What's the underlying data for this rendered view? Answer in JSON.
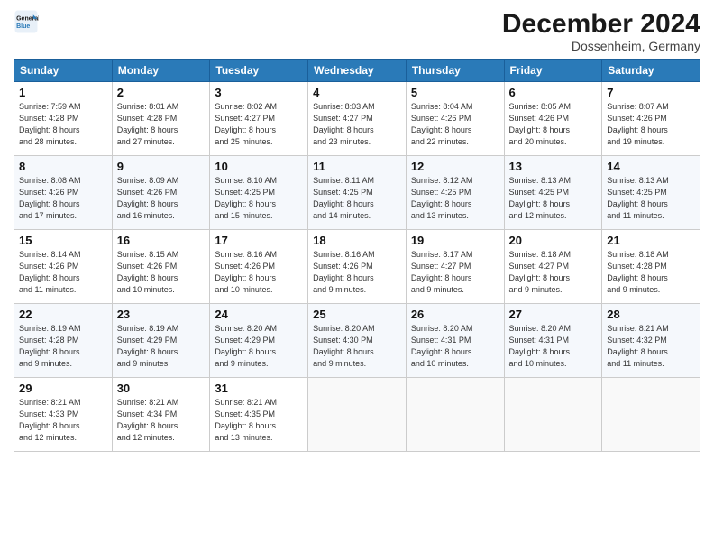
{
  "header": {
    "logo_line1": "General",
    "logo_line2": "Blue",
    "month": "December 2024",
    "location": "Dossenheim, Germany"
  },
  "weekdays": [
    "Sunday",
    "Monday",
    "Tuesday",
    "Wednesday",
    "Thursday",
    "Friday",
    "Saturday"
  ],
  "weeks": [
    [
      {
        "day": "1",
        "info": "Sunrise: 7:59 AM\nSunset: 4:28 PM\nDaylight: 8 hours\nand 28 minutes."
      },
      {
        "day": "2",
        "info": "Sunrise: 8:01 AM\nSunset: 4:28 PM\nDaylight: 8 hours\nand 27 minutes."
      },
      {
        "day": "3",
        "info": "Sunrise: 8:02 AM\nSunset: 4:27 PM\nDaylight: 8 hours\nand 25 minutes."
      },
      {
        "day": "4",
        "info": "Sunrise: 8:03 AM\nSunset: 4:27 PM\nDaylight: 8 hours\nand 23 minutes."
      },
      {
        "day": "5",
        "info": "Sunrise: 8:04 AM\nSunset: 4:26 PM\nDaylight: 8 hours\nand 22 minutes."
      },
      {
        "day": "6",
        "info": "Sunrise: 8:05 AM\nSunset: 4:26 PM\nDaylight: 8 hours\nand 20 minutes."
      },
      {
        "day": "7",
        "info": "Sunrise: 8:07 AM\nSunset: 4:26 PM\nDaylight: 8 hours\nand 19 minutes."
      }
    ],
    [
      {
        "day": "8",
        "info": "Sunrise: 8:08 AM\nSunset: 4:26 PM\nDaylight: 8 hours\nand 17 minutes."
      },
      {
        "day": "9",
        "info": "Sunrise: 8:09 AM\nSunset: 4:26 PM\nDaylight: 8 hours\nand 16 minutes."
      },
      {
        "day": "10",
        "info": "Sunrise: 8:10 AM\nSunset: 4:25 PM\nDaylight: 8 hours\nand 15 minutes."
      },
      {
        "day": "11",
        "info": "Sunrise: 8:11 AM\nSunset: 4:25 PM\nDaylight: 8 hours\nand 14 minutes."
      },
      {
        "day": "12",
        "info": "Sunrise: 8:12 AM\nSunset: 4:25 PM\nDaylight: 8 hours\nand 13 minutes."
      },
      {
        "day": "13",
        "info": "Sunrise: 8:13 AM\nSunset: 4:25 PM\nDaylight: 8 hours\nand 12 minutes."
      },
      {
        "day": "14",
        "info": "Sunrise: 8:13 AM\nSunset: 4:25 PM\nDaylight: 8 hours\nand 11 minutes."
      }
    ],
    [
      {
        "day": "15",
        "info": "Sunrise: 8:14 AM\nSunset: 4:26 PM\nDaylight: 8 hours\nand 11 minutes."
      },
      {
        "day": "16",
        "info": "Sunrise: 8:15 AM\nSunset: 4:26 PM\nDaylight: 8 hours\nand 10 minutes."
      },
      {
        "day": "17",
        "info": "Sunrise: 8:16 AM\nSunset: 4:26 PM\nDaylight: 8 hours\nand 10 minutes."
      },
      {
        "day": "18",
        "info": "Sunrise: 8:16 AM\nSunset: 4:26 PM\nDaylight: 8 hours\nand 9 minutes."
      },
      {
        "day": "19",
        "info": "Sunrise: 8:17 AM\nSunset: 4:27 PM\nDaylight: 8 hours\nand 9 minutes."
      },
      {
        "day": "20",
        "info": "Sunrise: 8:18 AM\nSunset: 4:27 PM\nDaylight: 8 hours\nand 9 minutes."
      },
      {
        "day": "21",
        "info": "Sunrise: 8:18 AM\nSunset: 4:28 PM\nDaylight: 8 hours\nand 9 minutes."
      }
    ],
    [
      {
        "day": "22",
        "info": "Sunrise: 8:19 AM\nSunset: 4:28 PM\nDaylight: 8 hours\nand 9 minutes."
      },
      {
        "day": "23",
        "info": "Sunrise: 8:19 AM\nSunset: 4:29 PM\nDaylight: 8 hours\nand 9 minutes."
      },
      {
        "day": "24",
        "info": "Sunrise: 8:20 AM\nSunset: 4:29 PM\nDaylight: 8 hours\nand 9 minutes."
      },
      {
        "day": "25",
        "info": "Sunrise: 8:20 AM\nSunset: 4:30 PM\nDaylight: 8 hours\nand 9 minutes."
      },
      {
        "day": "26",
        "info": "Sunrise: 8:20 AM\nSunset: 4:31 PM\nDaylight: 8 hours\nand 10 minutes."
      },
      {
        "day": "27",
        "info": "Sunrise: 8:20 AM\nSunset: 4:31 PM\nDaylight: 8 hours\nand 10 minutes."
      },
      {
        "day": "28",
        "info": "Sunrise: 8:21 AM\nSunset: 4:32 PM\nDaylight: 8 hours\nand 11 minutes."
      }
    ],
    [
      {
        "day": "29",
        "info": "Sunrise: 8:21 AM\nSunset: 4:33 PM\nDaylight: 8 hours\nand 12 minutes."
      },
      {
        "day": "30",
        "info": "Sunrise: 8:21 AM\nSunset: 4:34 PM\nDaylight: 8 hours\nand 12 minutes."
      },
      {
        "day": "31",
        "info": "Sunrise: 8:21 AM\nSunset: 4:35 PM\nDaylight: 8 hours\nand 13 minutes."
      },
      null,
      null,
      null,
      null
    ]
  ]
}
